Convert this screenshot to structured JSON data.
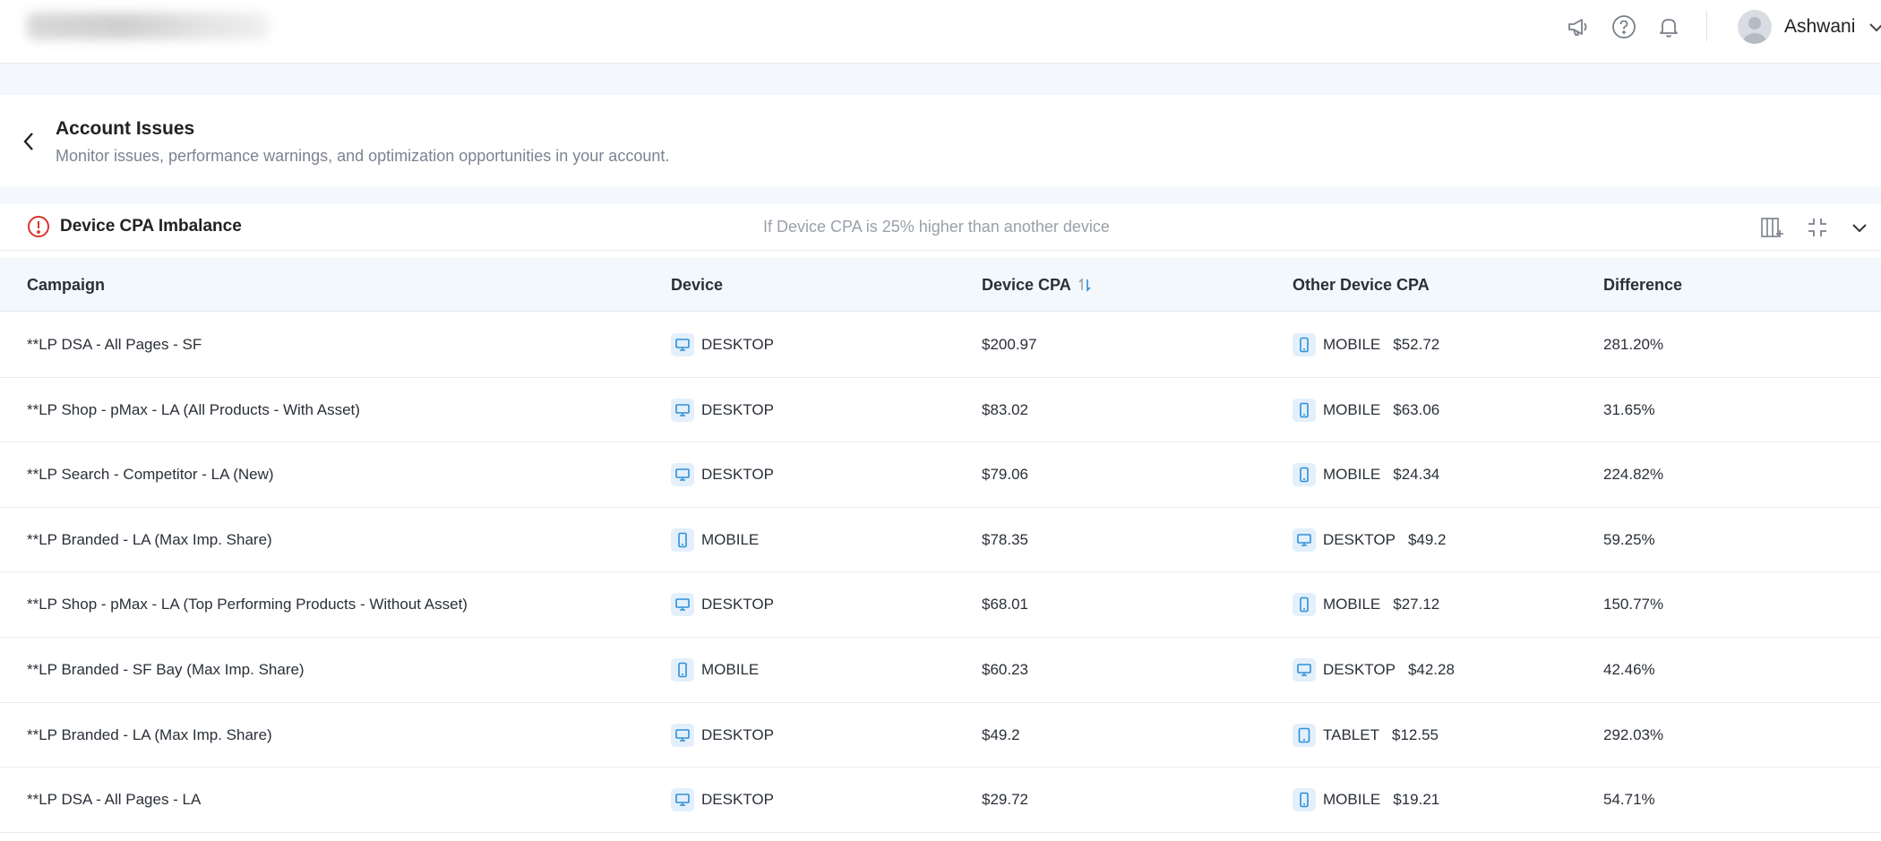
{
  "topbar": {
    "icons": [
      "megaphone-icon",
      "help-icon",
      "bell-icon"
    ],
    "user": {
      "name": "Ashwani"
    }
  },
  "header": {
    "title": "Account Issues",
    "subtitle": "Monitor issues, performance warnings, and optimization opportunities in your account."
  },
  "issue": {
    "title": "Device CPA Imbalance",
    "description": "If Device CPA is 25% higher than another device",
    "icon_color": "#d9342b"
  },
  "table": {
    "columns": [
      "Campaign",
      "Device",
      "Device CPA",
      "Other Device CPA",
      "Difference"
    ],
    "sorted_column": "Device CPA",
    "rows": [
      {
        "campaign": "**LP DSA - All Pages - SF",
        "device": "DESKTOP",
        "device_cpa": "$200.97",
        "other_device": "MOBILE",
        "other_cpa": "$52.72",
        "difference": "281.20%"
      },
      {
        "campaign": "**LP Shop - pMax - LA (All Products - With Asset)",
        "device": "DESKTOP",
        "device_cpa": "$83.02",
        "other_device": "MOBILE",
        "other_cpa": "$63.06",
        "difference": "31.65%"
      },
      {
        "campaign": "**LP Search - Competitor - LA (New)",
        "device": "DESKTOP",
        "device_cpa": "$79.06",
        "other_device": "MOBILE",
        "other_cpa": "$24.34",
        "difference": "224.82%"
      },
      {
        "campaign": "**LP Branded - LA (Max Imp. Share)",
        "device": "MOBILE",
        "device_cpa": "$78.35",
        "other_device": "DESKTOP",
        "other_cpa": "$49.2",
        "difference": "59.25%"
      },
      {
        "campaign": "**LP Shop - pMax - LA (Top Performing Products - Without Asset)",
        "device": "DESKTOP",
        "device_cpa": "$68.01",
        "other_device": "MOBILE",
        "other_cpa": "$27.12",
        "difference": "150.77%"
      },
      {
        "campaign": "**LP Branded - SF Bay (Max Imp. Share)",
        "device": "MOBILE",
        "device_cpa": "$60.23",
        "other_device": "DESKTOP",
        "other_cpa": "$42.28",
        "difference": "42.46%"
      },
      {
        "campaign": "**LP Branded - LA (Max Imp. Share)",
        "device": "DESKTOP",
        "device_cpa": "$49.2",
        "other_device": "TABLET",
        "other_cpa": "$12.55",
        "difference": "292.03%"
      },
      {
        "campaign": "**LP DSA - All Pages - LA",
        "device": "DESKTOP",
        "device_cpa": "$29.72",
        "other_device": "MOBILE",
        "other_cpa": "$19.21",
        "difference": "54.71%"
      }
    ]
  },
  "colors": {
    "accent": "#2f8fd6",
    "badge_bg": "#e3f0fb",
    "header_bg": "#f3f8fd",
    "muted_text": "#7c8390"
  }
}
